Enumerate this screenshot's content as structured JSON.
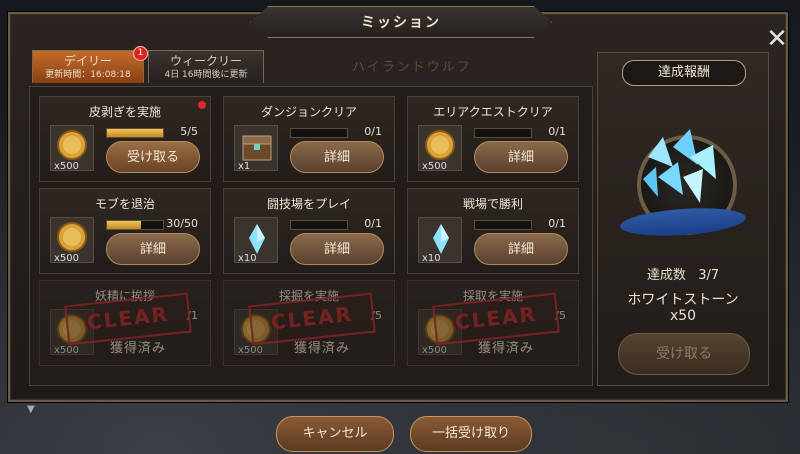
{
  "window": {
    "title": "ミッション",
    "close_icon": "close-icon"
  },
  "tabs": {
    "daily": {
      "label": "デイリー",
      "sub": "更新時間：16:08:18",
      "badge": "1"
    },
    "weekly": {
      "label": "ウィークリー",
      "sub": "4日 16時間後に更新"
    }
  },
  "bg_text": "ハイランドウルフ",
  "missions": [
    {
      "name": "皮剥ぎを実施",
      "icon": "gold-coin-icon",
      "qty": "x500",
      "progress": "5/5",
      "progress_fraction": 1.0,
      "button": "受け取る",
      "state": "claim",
      "has_dot": true
    },
    {
      "name": "ダンジョンクリア",
      "icon": "treasure-chest-icon",
      "qty": "x1",
      "progress": "0/1",
      "progress_fraction": 0,
      "button": "詳細",
      "state": "open"
    },
    {
      "name": "エリアクエストクリア",
      "icon": "gold-coin-icon",
      "qty": "x500",
      "progress": "0/1",
      "progress_fraction": 0,
      "button": "詳細",
      "state": "open"
    },
    {
      "name": "モブを退治",
      "icon": "gold-coin-icon",
      "qty": "x500",
      "progress": "30/50",
      "progress_fraction": 0.6,
      "button": "詳細",
      "state": "open"
    },
    {
      "name": "闘技場をプレイ",
      "icon": "white-stone-icon",
      "qty": "x10",
      "progress": "0/1",
      "progress_fraction": 0,
      "button": "詳細",
      "state": "open"
    },
    {
      "name": "戦場で勝利",
      "icon": "white-stone-icon",
      "qty": "x10",
      "progress": "0/1",
      "progress_fraction": 0,
      "button": "詳細",
      "state": "open"
    },
    {
      "name": "妖精に挨拶",
      "icon": "gold-coin-icon",
      "qty": "x500",
      "progress": "/1",
      "button": "獲得済み",
      "state": "done",
      "stamp": "CLEAR"
    },
    {
      "name": "採掘を実施",
      "icon": "gold-coin-icon",
      "qty": "x500",
      "progress": "/5",
      "button": "獲得済み",
      "state": "done",
      "stamp": "CLEAR"
    },
    {
      "name": "採取を実施",
      "icon": "gold-coin-icon",
      "qty": "x500",
      "progress": "/5",
      "button": "獲得済み",
      "state": "done",
      "stamp": "CLEAR"
    }
  ],
  "reward": {
    "title": "達成報酬",
    "count_label": "達成数",
    "count": "3/7",
    "item_name": "ホワイトストーン",
    "item_qty": "x50",
    "button": "受け取る",
    "icon": "white-stone-bundle-icon"
  },
  "footer": {
    "cancel": "キャンセル",
    "claim_all": "一括受け取り"
  },
  "colors": {
    "accent": "#c46b2a",
    "stamp": "#c12a2a",
    "ribbon": "#2f5aa6"
  }
}
